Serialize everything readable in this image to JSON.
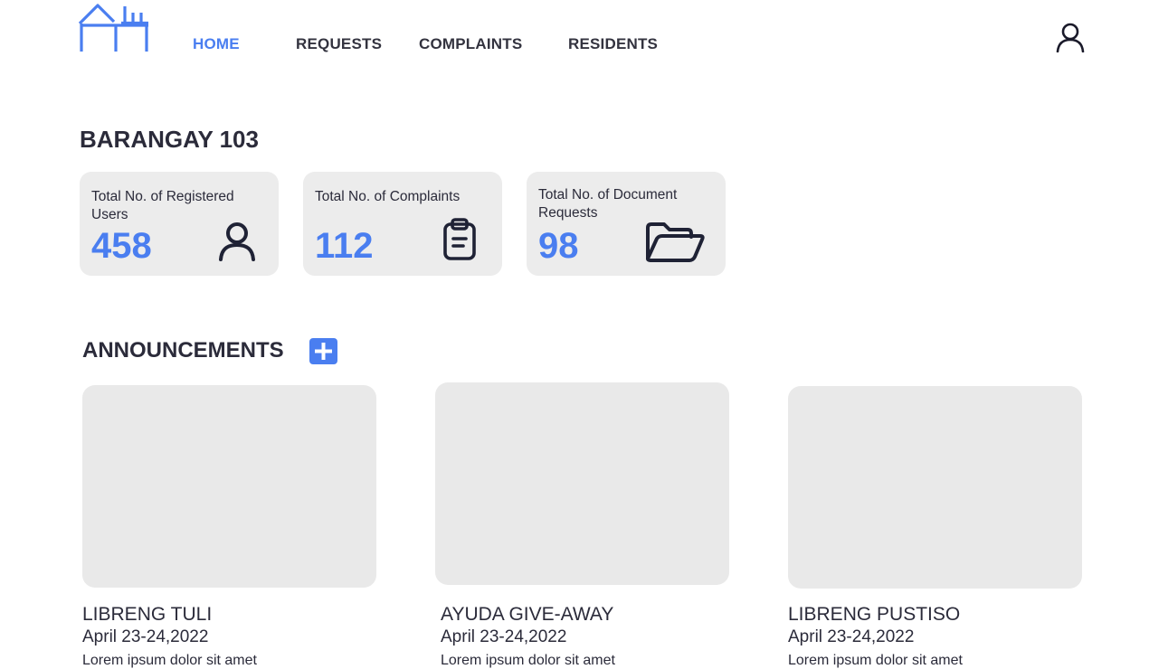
{
  "nav": {
    "items": [
      {
        "label": "HOME",
        "active": true
      },
      {
        "label": "REQUESTS",
        "active": false
      },
      {
        "label": "COMPLAINTS",
        "active": false
      },
      {
        "label": "RESIDENTS",
        "active": false
      }
    ]
  },
  "page": {
    "title": "BARANGAY 103"
  },
  "stats": [
    {
      "label": "Total No. of Registered Users",
      "value": "458",
      "icon": "user-icon"
    },
    {
      "label": "Total No. of Complaints",
      "value": "112",
      "icon": "clipboard-icon"
    },
    {
      "label": "Total No. of Document Requests",
      "value": "98",
      "icon": "folder-open-icon"
    }
  ],
  "announcements": {
    "title": "ANNOUNCEMENTS",
    "add_icon": "plus-icon",
    "items": [
      {
        "title": "LIBRENG TULI",
        "date": "April 23-24,2022",
        "desc": "Lorem ipsum dolor sit amet"
      },
      {
        "title": "AYUDA GIVE-AWAY",
        "date": "April 23-24,2022",
        "desc": "Lorem ipsum dolor sit amet"
      },
      {
        "title": "LIBRENG PUSTISO",
        "date": "April 23-24,2022",
        "desc": "Lorem ipsum dolor sit amet"
      }
    ]
  },
  "colors": {
    "accent": "#4a7ef0",
    "card_bg": "#ececec",
    "text": "#2b2b3a"
  }
}
